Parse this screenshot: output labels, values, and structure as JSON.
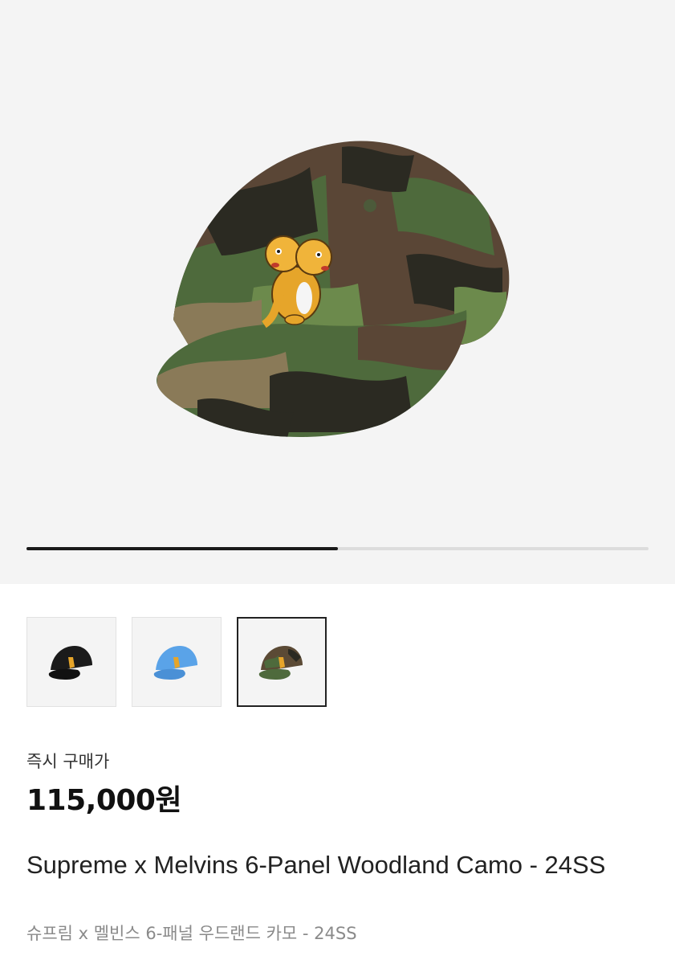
{
  "gallery": {
    "main_image": "supreme-melvins-cap-woodland-camo",
    "progress": 0.5,
    "thumbnails": [
      {
        "name": "cap-black",
        "color": "#1b1b1b",
        "selected": false
      },
      {
        "name": "cap-blue",
        "color": "#5aa3e8",
        "selected": false
      },
      {
        "name": "cap-camo",
        "color": "#5b4a35",
        "selected": true
      }
    ]
  },
  "pricing": {
    "label": "즉시 구매가",
    "price": "115,000원"
  },
  "product": {
    "title": "Supreme x Melvins 6-Panel Woodland Camo - 24SS",
    "subtitle": "슈프림 x 멜빈스 6-패널 우드랜드 카모 - 24SS"
  },
  "colors": {
    "hero_bg": "#f4f4f4",
    "progress_active": "#1a1a1a",
    "progress_track": "#dcdcdc",
    "subtitle_text": "#8a8a8a"
  }
}
